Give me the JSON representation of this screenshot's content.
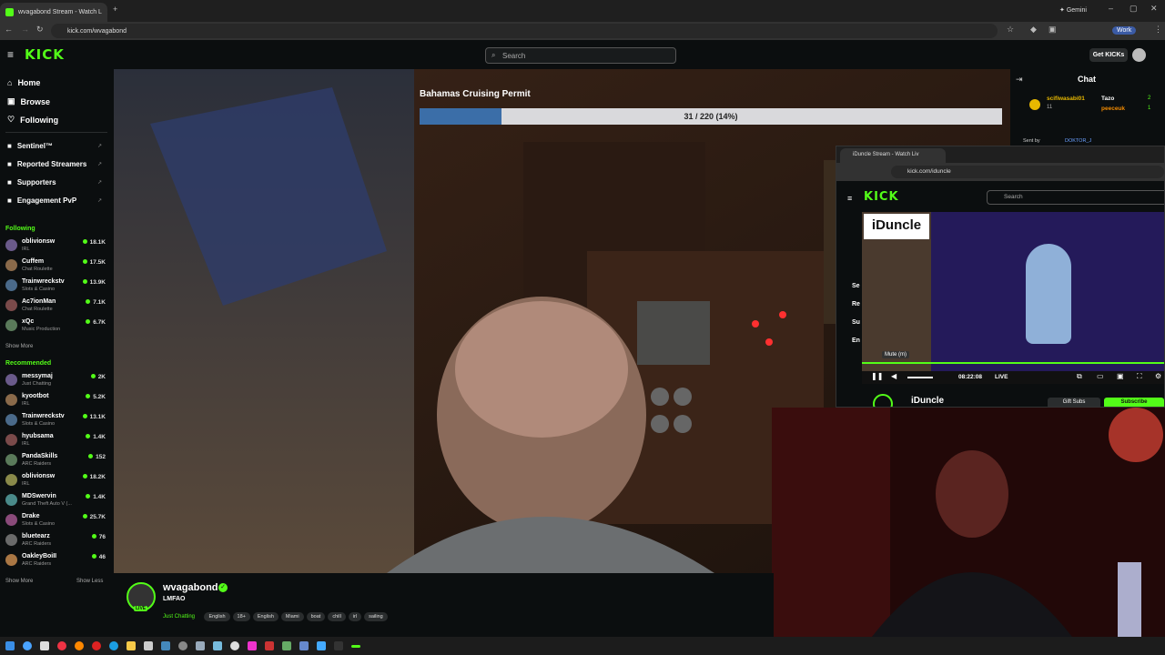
{
  "browser": {
    "tab_title": "wvagabond Stream - Watch L",
    "new_tab": "+",
    "url": "kick.com/wvagabond",
    "gemini_label": "Gemini",
    "profile_label": "Work"
  },
  "header": {
    "logo": "KICK",
    "search_placeholder": "Search",
    "get_kicks": "Get KICKs"
  },
  "sidebar": {
    "nav": [
      {
        "label": "Home"
      },
      {
        "label": "Browse"
      },
      {
        "label": "Following"
      }
    ],
    "extras": [
      {
        "label": "Sentinel™"
      },
      {
        "label": "Reported Streamers"
      },
      {
        "label": "Supporters"
      },
      {
        "label": "Engagement PvP"
      }
    ],
    "following_title": "Following",
    "following": [
      {
        "name": "oblivionsw",
        "category": "IRL",
        "viewers": "18.1K"
      },
      {
        "name": "Cuffem",
        "category": "Chat Roulette",
        "viewers": "17.5K"
      },
      {
        "name": "Trainwreckstv",
        "category": "Slots & Casino",
        "viewers": "13.9K"
      },
      {
        "name": "Ac7ionMan",
        "category": "Chat Roulette",
        "viewers": "7.1K"
      },
      {
        "name": "xQc",
        "category": "Music Production",
        "viewers": "6.7K"
      }
    ],
    "show_more_1": "Show More",
    "recommended_title": "Recommended",
    "recommended": [
      {
        "name": "messymaj",
        "category": "Just Chatting",
        "viewers": "2K"
      },
      {
        "name": "kyootbot",
        "category": "IRL",
        "viewers": "5.2K"
      },
      {
        "name": "Trainwreckstv",
        "category": "Slots & Casino",
        "viewers": "13.1K"
      },
      {
        "name": "hyubsama",
        "category": "IRL",
        "viewers": "1.4K"
      },
      {
        "name": "PandaSkills",
        "category": "ARC Raiders",
        "viewers": "152"
      },
      {
        "name": "oblivionsw",
        "category": "IRL",
        "viewers": "18.2K"
      },
      {
        "name": "MDSwervin",
        "category": "Grand Theft Auto V (...",
        "viewers": "1.4K"
      },
      {
        "name": "Drake",
        "category": "Slots & Casino",
        "viewers": "25.7K"
      },
      {
        "name": "bluetearz",
        "category": "ARC Raiders",
        "viewers": "76"
      },
      {
        "name": "OakleyBoiII",
        "category": "ARC Raiders",
        "viewers": "46"
      }
    ],
    "show_more_2": "Show More",
    "show_less": "Show Less"
  },
  "overlay": {
    "goal_title": "Bahamas Cruising Permit",
    "goal_progress": "31 / 220 (14%)",
    "goal_fraction": 0.14
  },
  "stream_info": {
    "channel": "wvagabond",
    "title": "LMFAO",
    "category": "Just Chatting",
    "live_badge": "LIVE",
    "tags": [
      "English",
      "18+",
      "English",
      "Miami",
      "boat",
      "chill",
      "irl",
      "sailing"
    ]
  },
  "chat": {
    "title": "Chat",
    "gifter_1": "scifiwasabi01",
    "gifter_1_count": "11",
    "gifter_2": "Tazo",
    "gifter_2_count": "2",
    "gifter_3": "peeceuk",
    "gifter_3_count": "1",
    "pinned_line": "Sent by",
    "pinned_user": "DOKTOR_J"
  },
  "inner_window": {
    "tab_title": "iDuncle Stream - Watch Liv",
    "url": "kick.com/iduncle",
    "logo": "KICK",
    "search_placeholder": "Search",
    "channel_banner": "iDuncle",
    "time": "08:22:08",
    "live": "LIVE",
    "tooltip": "Mute (m)",
    "channel_name": "iDuncle",
    "gift_subs": "Gift Subs",
    "subscribe": "Subscribe",
    "side_letters": [
      "Se",
      "Re",
      "Su",
      "En"
    ]
  },
  "colors": {
    "brand": "#53fc18",
    "bg": "#0b0e0f"
  }
}
